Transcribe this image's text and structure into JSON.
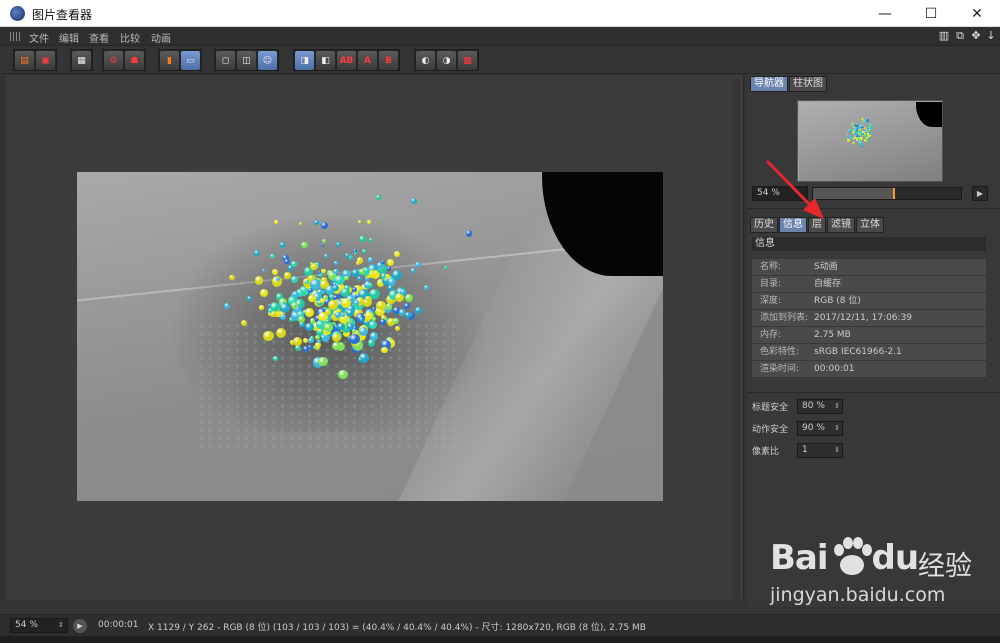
{
  "window": {
    "title": "图片查看器",
    "minimize_glyph": "—",
    "maximize_glyph": "☐",
    "close_glyph": "✕"
  },
  "menubar": {
    "items": [
      "文件",
      "编辑",
      "查看",
      "比较",
      "动画"
    ]
  },
  "toolbar": {
    "ab_label": "AB",
    "a_label": "A",
    "b_label": "B"
  },
  "navigator": {
    "tabs": [
      "导航器",
      "柱状图"
    ],
    "zoom_value": "54 %",
    "zoom_level": 0.54
  },
  "info_panel": {
    "tabs": [
      "历史",
      "信息",
      "层",
      "滤镜",
      "立体"
    ],
    "section_title": "信息",
    "rows": [
      {
        "key": "名称:",
        "value": "S动画"
      },
      {
        "key": "目录:",
        "value": "自缓存"
      },
      {
        "key": "深度:",
        "value": "RGB (8 位)"
      },
      {
        "key": "添加到列表:",
        "value": "2017/12/11, 17:06:39"
      },
      {
        "key": "内存:",
        "value": "2.75 MB"
      },
      {
        "key": "色彩特性:",
        "value": "sRGB IEC61966-2.1"
      },
      {
        "key": "渲染时间:",
        "value": "00:00:01"
      }
    ]
  },
  "settings": {
    "title_safe_label": "标题安全",
    "title_safe_value": "80 %",
    "action_safe_label": "动作安全",
    "action_safe_value": "90 %",
    "pixel_ratio_label": "像素比",
    "pixel_ratio_value": "1"
  },
  "statusbar": {
    "zoom_value": "54 %",
    "time": "00:00:01",
    "info": "X 1129 / Y 262 - RGB (8 位) (103 / 103 / 103) = (40.4% / 40.4% / 40.4%) - 尺寸: 1280x720, RGB (8 位), 2.75 MB"
  },
  "watermark": {
    "logo": "Bai",
    "logo_suffix": "du",
    "cn": "经验",
    "url": "jingyan.baidu.com"
  },
  "colors": {
    "accent_tab": "#6a83ad",
    "zoom_knob": "#ff9b1a",
    "annotation_arrow": "#e8282b"
  }
}
